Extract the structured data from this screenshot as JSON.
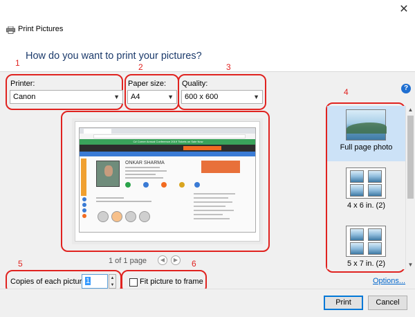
{
  "window": {
    "title": "Print Pictures",
    "question": "How do you want to print your pictures?"
  },
  "annotations": {
    "printer": "1",
    "paper": "2",
    "quality": "3",
    "layouts": "4",
    "copies": "5",
    "fit": "6"
  },
  "printer": {
    "label": "Printer:",
    "value": "Canon"
  },
  "paper": {
    "label": "Paper size:",
    "value": "A4"
  },
  "quality": {
    "label": "Quality:",
    "value": "600 x 600"
  },
  "preview": {
    "page_text": "1 of 1 page",
    "screenshot": {
      "banner": "C# Corner Annual Conference 2019 Tickets on Sale Now",
      "name": "ONKAR SHARMA"
    }
  },
  "layouts": [
    {
      "label": "Full page photo",
      "selected": true
    },
    {
      "label": "4 x 6 in. (2)",
      "selected": false
    },
    {
      "label": "5 x 7 in. (2)",
      "selected": false
    }
  ],
  "copies": {
    "label": "Copies of each picture:",
    "value": "1"
  },
  "fit": {
    "label": "Fit picture to frame",
    "checked": false
  },
  "options_link": "Options...",
  "buttons": {
    "print": "Print",
    "cancel": "Cancel"
  },
  "icons": {
    "app": "printer-icon",
    "close": "close-icon",
    "help": "help-icon",
    "prev": "prev-page-icon",
    "next": "next-page-icon"
  },
  "colors": {
    "annotation": "#e0221f",
    "selection": "#cce2f7",
    "link": "#0066cc"
  }
}
